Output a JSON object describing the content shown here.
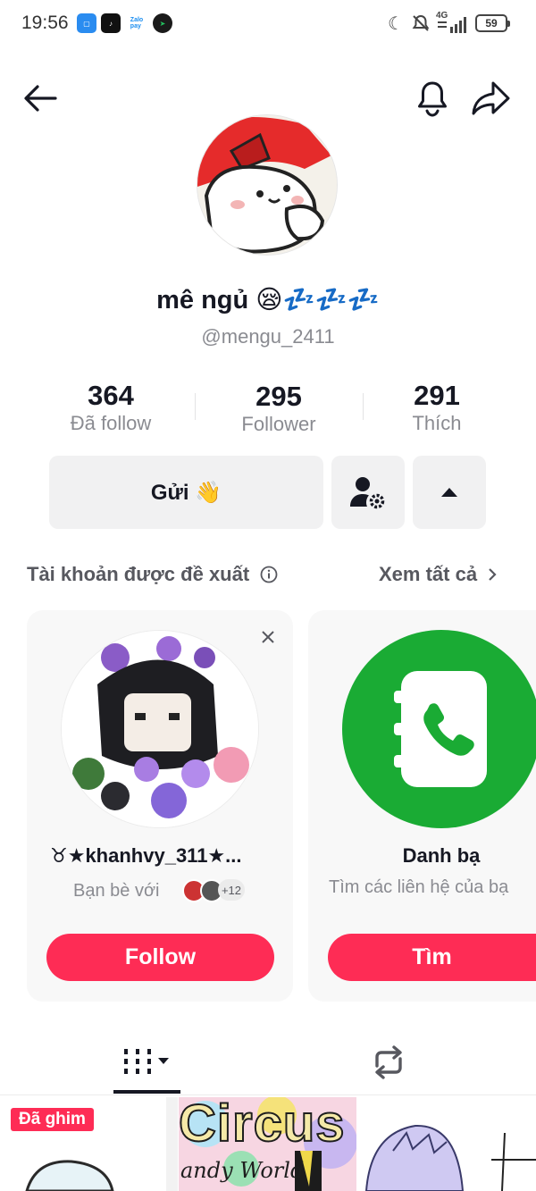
{
  "status_bar": {
    "time": "19:56",
    "network": "4G",
    "battery": "59",
    "app_icons": [
      "zalo-pay",
      "tiktok",
      "telegram"
    ]
  },
  "profile": {
    "display_name": "mê ngủ 😪💤💤💤",
    "username": "@mengu_2411",
    "stats": [
      {
        "value": "364",
        "label": "Đã follow"
      },
      {
        "value": "295",
        "label": "Follower"
      },
      {
        "value": "291",
        "label": "Thích"
      }
    ],
    "send_button": "Gửi 👋"
  },
  "suggested": {
    "title": "Tài khoản được đề xuất",
    "see_all": "Xem tất cả",
    "cards": [
      {
        "name": "♉★khanhvy_311★...",
        "subtitle": "Bạn bè với",
        "mutual_count": "+12",
        "button": "Follow"
      },
      {
        "name": "Danh bạ",
        "subtitle": "Tìm các liên hệ của bạ",
        "button": "Tìm"
      }
    ]
  },
  "videos": {
    "pinned_badge": "Đã ghim",
    "thumb2_text_top": "Circus",
    "thumb2_text_bottom": "andy World"
  },
  "colors": {
    "accent": "#fe2c55",
    "contacts_green": "#1aab34",
    "text_primary": "#161823",
    "text_secondary": "#8a8b91"
  }
}
